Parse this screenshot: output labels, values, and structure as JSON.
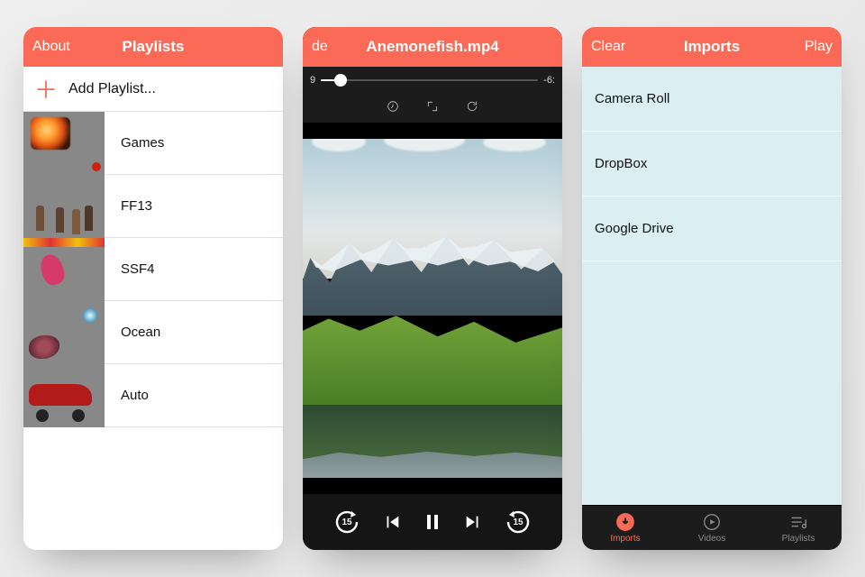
{
  "colors": {
    "accent": "#fa6a56"
  },
  "screens": {
    "playlists": {
      "nav": {
        "left": "About",
        "title": "Playlists",
        "right": ""
      },
      "add_label": "Add Playlist...",
      "items": [
        {
          "label": "Games",
          "thumb": "games"
        },
        {
          "label": "FF13",
          "thumb": "ff13"
        },
        {
          "label": "SSF4",
          "thumb": "ssf4"
        },
        {
          "label": "Ocean",
          "thumb": "ocean"
        },
        {
          "label": "Auto",
          "thumb": "auto"
        }
      ]
    },
    "player": {
      "nav": {
        "left": "de",
        "title": "Anemonefish.mp4",
        "right": ""
      },
      "time": {
        "elapsed": "9",
        "remaining": "-6:",
        "progress_pct": 9
      },
      "skip_seconds": "15"
    },
    "imports": {
      "nav": {
        "left": "Clear",
        "title": "Imports",
        "right": "Play"
      },
      "sources": [
        {
          "label": "Camera Roll"
        },
        {
          "label": "DropBox"
        },
        {
          "label": "Google Drive"
        }
      ],
      "tabs": [
        {
          "label": "Imports",
          "active": true
        },
        {
          "label": "Videos",
          "active": false
        },
        {
          "label": "Playlists",
          "active": false
        }
      ]
    }
  }
}
